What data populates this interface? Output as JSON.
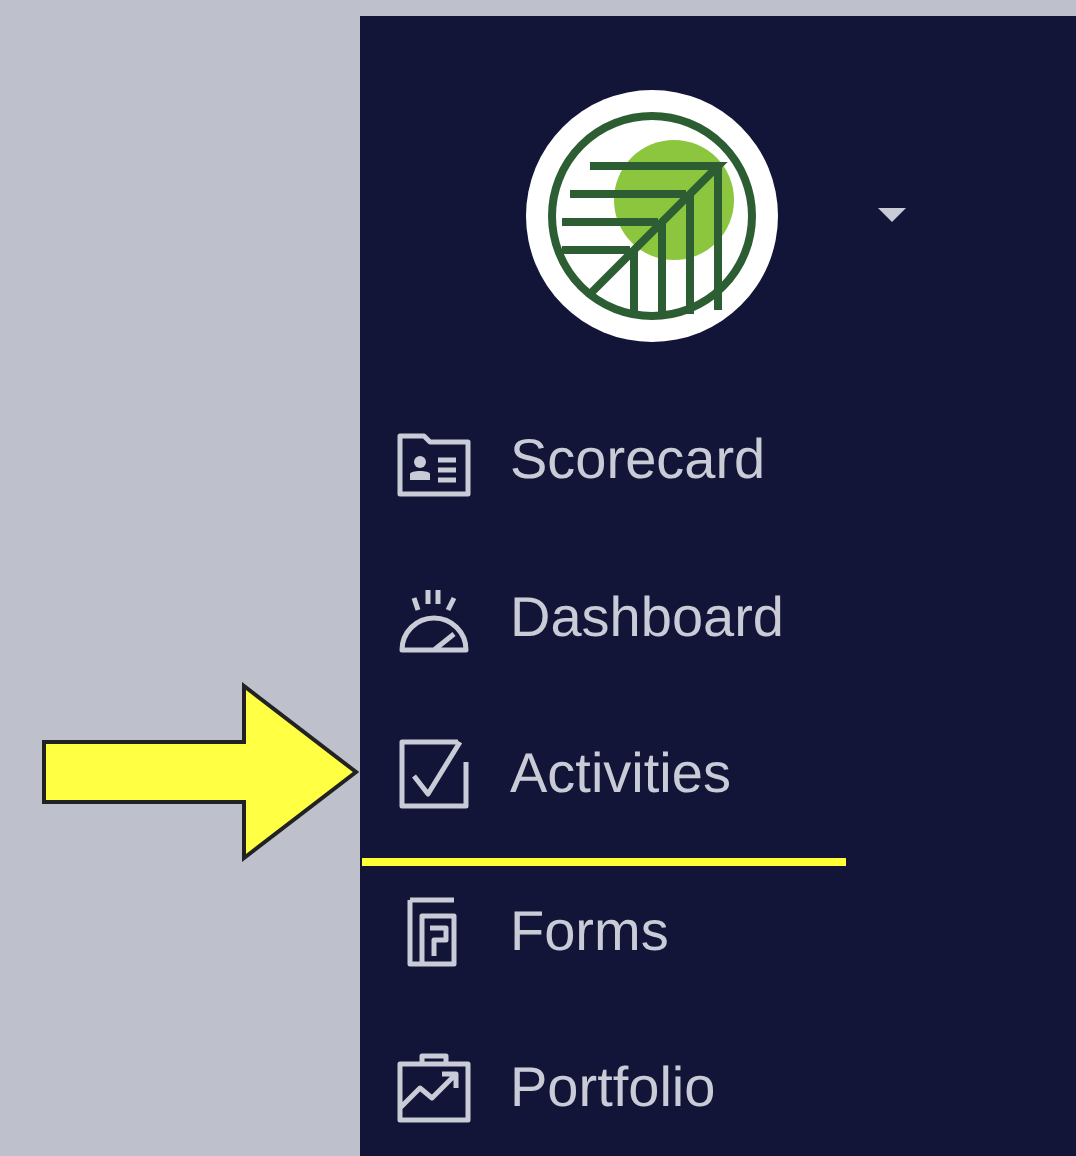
{
  "sidebar": {
    "has_dropdown": true,
    "items": [
      {
        "label": "Scorecard",
        "highlighted": false
      },
      {
        "label": "Dashboard",
        "highlighted": false
      },
      {
        "label": "Activities",
        "highlighted": true
      },
      {
        "label": "Forms",
        "highlighted": false
      },
      {
        "label": "Portfolio",
        "highlighted": false
      }
    ]
  }
}
